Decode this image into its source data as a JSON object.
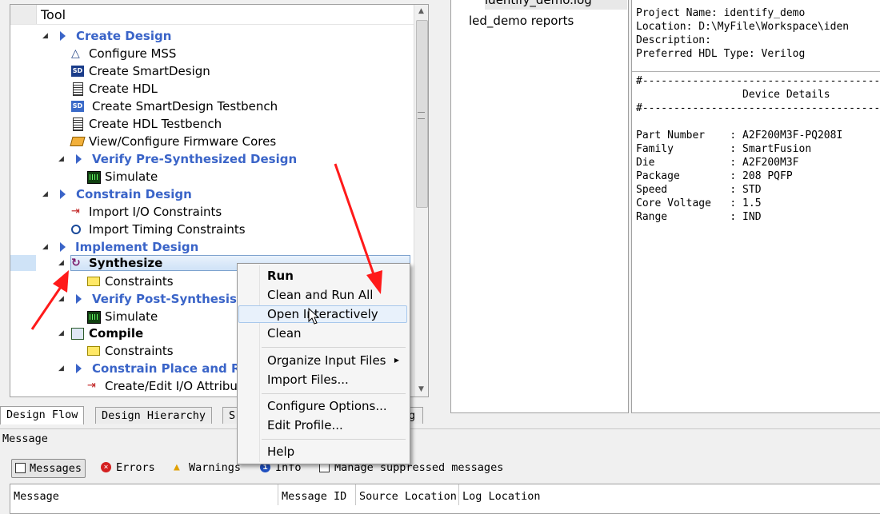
{
  "tool_panel": {
    "header": "Tool",
    "items": [
      {
        "label": "Create Design",
        "style": "group"
      },
      {
        "label": "Configure MSS",
        "style": "tool",
        "icon": "configure-mss-icon"
      },
      {
        "label": "Create SmartDesign",
        "style": "tool",
        "icon": "smartdesign-icon",
        "badge": "SD"
      },
      {
        "label": "Create HDL",
        "style": "tool",
        "icon": "hdl-document-icon"
      },
      {
        "label": "Create SmartDesign Testbench",
        "style": "tool",
        "icon": "smartdesign-testbench-icon",
        "badge": "SD"
      },
      {
        "label": "Create HDL Testbench",
        "style": "tool",
        "icon": "hdl-document-icon"
      },
      {
        "label": "View/Configure Firmware Cores",
        "style": "tool",
        "icon": "firmware-cores-icon"
      },
      {
        "label": "Verify Pre-Synthesized Design",
        "style": "group"
      },
      {
        "label": "Simulate",
        "style": "tool",
        "icon": "simulate-icon"
      },
      {
        "label": "Constrain Design",
        "style": "group"
      },
      {
        "label": "Import I/O Constraints",
        "style": "tool",
        "icon": "io-constraints-icon"
      },
      {
        "label": "Import Timing Constraints",
        "style": "tool",
        "icon": "stopwatch-icon"
      },
      {
        "label": "Implement Design",
        "style": "group"
      },
      {
        "label": "Synthesize",
        "style": "bold",
        "icon": "synthesize-icon"
      },
      {
        "label": "Constraints",
        "style": "tool",
        "icon": "folder-icon"
      },
      {
        "label": "Verify Post-Synthesis Im",
        "style": "group"
      },
      {
        "label": "Simulate",
        "style": "tool",
        "icon": "simulate-icon"
      },
      {
        "label": "Compile",
        "style": "bold",
        "icon": "compile-icon"
      },
      {
        "label": "Constraints",
        "style": "tool",
        "icon": "folder-icon"
      },
      {
        "label": "Constrain Place and Rou",
        "style": "group"
      },
      {
        "label": "Create/Edit I/O Attribu",
        "style": "tool",
        "icon": "io-attributes-icon"
      }
    ]
  },
  "tabs": [
    "Design Flow",
    "Design Hierarchy",
    "S",
    "g"
  ],
  "reports": {
    "items": [
      "identify_demo.log",
      "led_demo reports"
    ]
  },
  "log": {
    "lines": [
      "Project Name: identify_demo",
      "Location: D:\\MyFile\\Workspace\\iden",
      "Description:",
      "Preferred HDL Type: Verilog",
      "",
      "#------------------------------------------",
      "                 Device Details",
      "#------------------------------------------",
      "",
      "Part Number    : A2F200M3F-PQ208I",
      "Family         : SmartFusion",
      "Die            : A2F200M3F",
      "Package        : 208 PQFP",
      "Speed          : STD",
      "Core Voltage   : 1.5",
      "Range          : IND"
    ]
  },
  "context_menu": {
    "items": [
      {
        "label": "Run",
        "bold": true
      },
      {
        "label": "Clean and Run All"
      },
      {
        "label": "Open Interactively",
        "highlighted": true
      },
      {
        "label": "Clean"
      },
      {
        "label": "Organize Input Files",
        "submenu": true
      },
      {
        "label": "Import Files..."
      },
      {
        "label": "Configure Options..."
      },
      {
        "label": "Edit Profile..."
      },
      {
        "label": "Help"
      }
    ]
  },
  "message_panel": {
    "title": "Message",
    "toolbar": [
      "Messages",
      "Errors",
      "Warnings",
      "Info",
      "Manage suppressed messages"
    ],
    "columns": [
      "Message",
      "Message ID",
      "Source Location",
      "Log Location"
    ]
  },
  "colors": {
    "group_text": "#3a64c8",
    "annotation_arrow": "#ff1a1a",
    "selection": "#cfe2f7"
  }
}
